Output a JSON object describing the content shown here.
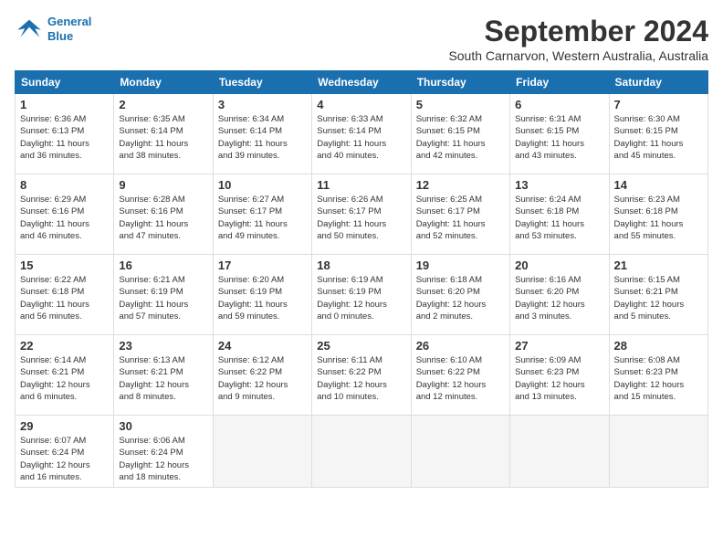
{
  "header": {
    "logo_line1": "General",
    "logo_line2": "Blue",
    "month_title": "September 2024",
    "subtitle": "South Carnarvon, Western Australia, Australia"
  },
  "weekdays": [
    "Sunday",
    "Monday",
    "Tuesday",
    "Wednesday",
    "Thursday",
    "Friday",
    "Saturday"
  ],
  "weeks": [
    [
      {
        "day": "1",
        "info": "Sunrise: 6:36 AM\nSunset: 6:13 PM\nDaylight: 11 hours\nand 36 minutes."
      },
      {
        "day": "2",
        "info": "Sunrise: 6:35 AM\nSunset: 6:14 PM\nDaylight: 11 hours\nand 38 minutes."
      },
      {
        "day": "3",
        "info": "Sunrise: 6:34 AM\nSunset: 6:14 PM\nDaylight: 11 hours\nand 39 minutes."
      },
      {
        "day": "4",
        "info": "Sunrise: 6:33 AM\nSunset: 6:14 PM\nDaylight: 11 hours\nand 40 minutes."
      },
      {
        "day": "5",
        "info": "Sunrise: 6:32 AM\nSunset: 6:15 PM\nDaylight: 11 hours\nand 42 minutes."
      },
      {
        "day": "6",
        "info": "Sunrise: 6:31 AM\nSunset: 6:15 PM\nDaylight: 11 hours\nand 43 minutes."
      },
      {
        "day": "7",
        "info": "Sunrise: 6:30 AM\nSunset: 6:15 PM\nDaylight: 11 hours\nand 45 minutes."
      }
    ],
    [
      {
        "day": "8",
        "info": "Sunrise: 6:29 AM\nSunset: 6:16 PM\nDaylight: 11 hours\nand 46 minutes."
      },
      {
        "day": "9",
        "info": "Sunrise: 6:28 AM\nSunset: 6:16 PM\nDaylight: 11 hours\nand 47 minutes."
      },
      {
        "day": "10",
        "info": "Sunrise: 6:27 AM\nSunset: 6:17 PM\nDaylight: 11 hours\nand 49 minutes."
      },
      {
        "day": "11",
        "info": "Sunrise: 6:26 AM\nSunset: 6:17 PM\nDaylight: 11 hours\nand 50 minutes."
      },
      {
        "day": "12",
        "info": "Sunrise: 6:25 AM\nSunset: 6:17 PM\nDaylight: 11 hours\nand 52 minutes."
      },
      {
        "day": "13",
        "info": "Sunrise: 6:24 AM\nSunset: 6:18 PM\nDaylight: 11 hours\nand 53 minutes."
      },
      {
        "day": "14",
        "info": "Sunrise: 6:23 AM\nSunset: 6:18 PM\nDaylight: 11 hours\nand 55 minutes."
      }
    ],
    [
      {
        "day": "15",
        "info": "Sunrise: 6:22 AM\nSunset: 6:18 PM\nDaylight: 11 hours\nand 56 minutes."
      },
      {
        "day": "16",
        "info": "Sunrise: 6:21 AM\nSunset: 6:19 PM\nDaylight: 11 hours\nand 57 minutes."
      },
      {
        "day": "17",
        "info": "Sunrise: 6:20 AM\nSunset: 6:19 PM\nDaylight: 11 hours\nand 59 minutes."
      },
      {
        "day": "18",
        "info": "Sunrise: 6:19 AM\nSunset: 6:19 PM\nDaylight: 12 hours\nand 0 minutes."
      },
      {
        "day": "19",
        "info": "Sunrise: 6:18 AM\nSunset: 6:20 PM\nDaylight: 12 hours\nand 2 minutes."
      },
      {
        "day": "20",
        "info": "Sunrise: 6:16 AM\nSunset: 6:20 PM\nDaylight: 12 hours\nand 3 minutes."
      },
      {
        "day": "21",
        "info": "Sunrise: 6:15 AM\nSunset: 6:21 PM\nDaylight: 12 hours\nand 5 minutes."
      }
    ],
    [
      {
        "day": "22",
        "info": "Sunrise: 6:14 AM\nSunset: 6:21 PM\nDaylight: 12 hours\nand 6 minutes."
      },
      {
        "day": "23",
        "info": "Sunrise: 6:13 AM\nSunset: 6:21 PM\nDaylight: 12 hours\nand 8 minutes."
      },
      {
        "day": "24",
        "info": "Sunrise: 6:12 AM\nSunset: 6:22 PM\nDaylight: 12 hours\nand 9 minutes."
      },
      {
        "day": "25",
        "info": "Sunrise: 6:11 AM\nSunset: 6:22 PM\nDaylight: 12 hours\nand 10 minutes."
      },
      {
        "day": "26",
        "info": "Sunrise: 6:10 AM\nSunset: 6:22 PM\nDaylight: 12 hours\nand 12 minutes."
      },
      {
        "day": "27",
        "info": "Sunrise: 6:09 AM\nSunset: 6:23 PM\nDaylight: 12 hours\nand 13 minutes."
      },
      {
        "day": "28",
        "info": "Sunrise: 6:08 AM\nSunset: 6:23 PM\nDaylight: 12 hours\nand 15 minutes."
      }
    ],
    [
      {
        "day": "29",
        "info": "Sunrise: 6:07 AM\nSunset: 6:24 PM\nDaylight: 12 hours\nand 16 minutes."
      },
      {
        "day": "30",
        "info": "Sunrise: 6:06 AM\nSunset: 6:24 PM\nDaylight: 12 hours\nand 18 minutes."
      },
      {
        "day": "",
        "info": ""
      },
      {
        "day": "",
        "info": ""
      },
      {
        "day": "",
        "info": ""
      },
      {
        "day": "",
        "info": ""
      },
      {
        "day": "",
        "info": ""
      }
    ]
  ]
}
